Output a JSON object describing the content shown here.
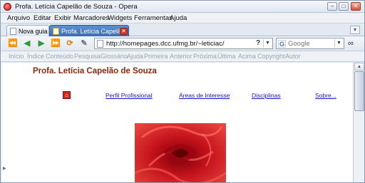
{
  "window": {
    "title": "Profa. Letícia Capelão de Souza - Opera",
    "app_icon": "opera-icon",
    "controls": {
      "minimize": "–",
      "maximize": "□",
      "close": "✕"
    }
  },
  "menu": {
    "items": [
      "Arquivo",
      "Editar",
      "Exibir",
      "Marcadores",
      "Widgets",
      "Ferramentas",
      "Ajuda"
    ]
  },
  "tabs": {
    "items": [
      {
        "label": "Nova guia",
        "active": false
      },
      {
        "label": "Profa. Letícia Capelão ...",
        "active": true
      }
    ],
    "close": "×",
    "menu": "▾"
  },
  "toolbar": {
    "buttons": [
      {
        "name": "rewind-icon",
        "glyph": "⏪",
        "color": "#2d6fb8"
      },
      {
        "name": "back-icon",
        "glyph": "◀",
        "color": "#2f9a2f"
      },
      {
        "name": "forward-icon",
        "glyph": "▶",
        "color": "#2f9a2f"
      },
      {
        "name": "fast-forward-icon",
        "glyph": "⏩",
        "color": "#2d6fb8"
      },
      {
        "name": "reload-icon",
        "glyph": "⟳",
        "color": "#d77b12"
      },
      {
        "name": "edit-pen-icon",
        "glyph": "✎",
        "color": "#6a7380"
      }
    ],
    "address_value": "http://homepages.dcc.ufmg.br/~leticiac/",
    "address_help": "?",
    "dropdown": "▼",
    "search_engine_icon": "G",
    "search_placeholder": "Google",
    "glasses": "∞"
  },
  "nav_links": [
    "Início",
    "Índice",
    "Conteúdo",
    "Pesquisa",
    "Glossário",
    "Ajuda",
    "Primeira",
    "Anterior",
    "Próxima",
    "Última",
    "Acima",
    "Copyright",
    "Autor"
  ],
  "page": {
    "heading": "Profa. Letícia Capelão de Souza",
    "home_glyph": "⌂",
    "links": [
      "Perfil Profissional",
      "Áreas de Interesse",
      "Disciplinas",
      "Sobre..."
    ]
  },
  "scrollbar": {
    "up": "▲",
    "down": "▼"
  }
}
